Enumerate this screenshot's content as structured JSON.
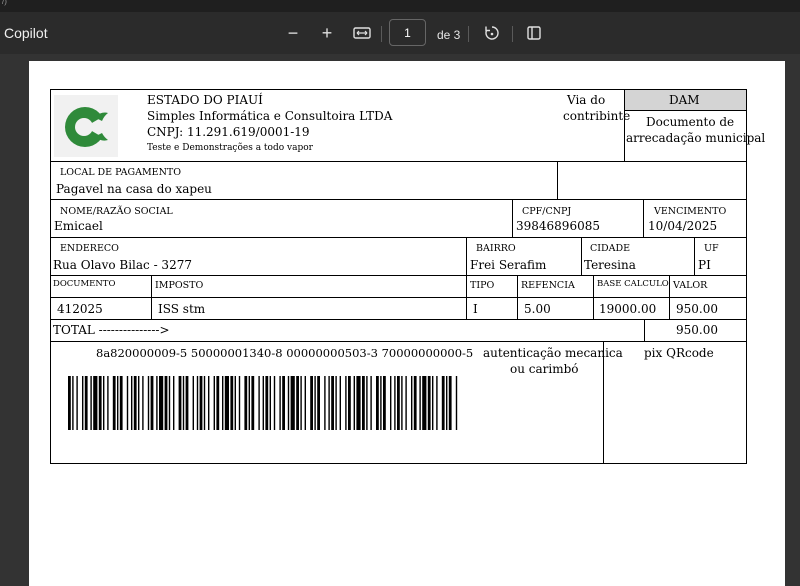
{
  "window": {
    "top_label": "/)"
  },
  "toolbar": {
    "app_title": "Copilot",
    "zoom_out_glyph": "−",
    "zoom_in_glyph": "+",
    "page_value": "1",
    "page_count": "de 3"
  },
  "doc": {
    "state": "ESTADO DO PIAUÍ",
    "company": "Simples Informática e Consultoira LTDA",
    "cnpj": "CNPJ: 11.291.619/0001-19",
    "tagline": "Teste e Demonstrações a todo vapor",
    "via_line1": "Via do",
    "via_line2": "contribinte",
    "dam": "DAM",
    "doc_type_line1": "Documento de",
    "doc_type_line2": "arrecadação municipal",
    "local_label": "LOCAL DE PAGAMENTO",
    "local_value": "Pagavel na casa do xapeu",
    "nome_label": "NOME/RAZÃO SOCIAL",
    "nome_value": "Emicael",
    "cpf_label": "CPF/CNPJ",
    "cpf_value": "39846896085",
    "venc_label": "VENCIMENTO",
    "venc_value": "10/04/2025",
    "endereco_label": "ENDERECO",
    "endereco_value": "Rua Olavo Bilac - 3277",
    "bairro_label": "BAIRRO",
    "bairro_value": "Frei Serafim",
    "cidade_label": "CIDADE",
    "cidade_value": "Teresina",
    "uf_label": "UF",
    "uf_value": "PI",
    "col_documento": "DOCUMENTO",
    "col_imposto": "IMPOSTO",
    "col_tipo": "TIPO",
    "col_refencia": "REFENCIA",
    "col_base": "BASE CALCULO",
    "col_valor": "VALOR",
    "row_documento": "412025",
    "row_imposto": "ISS stm",
    "row_tipo": "I",
    "row_refencia": "5.00",
    "row_base": "19000.00",
    "row_valor": "950.00",
    "total_label": "TOTAL --------------->",
    "total_value": "950.00",
    "barcode_line": "8a820000009-5 50000001340-8 00000000503-3 70000000000-5",
    "auth_line1": "autenticação mecanica",
    "auth_line2": "ou carimbó",
    "pix_label": "pix QRcode"
  },
  "colors": {
    "logo_green": "#2f8a3a",
    "dam_header": "#d4d4d4"
  }
}
